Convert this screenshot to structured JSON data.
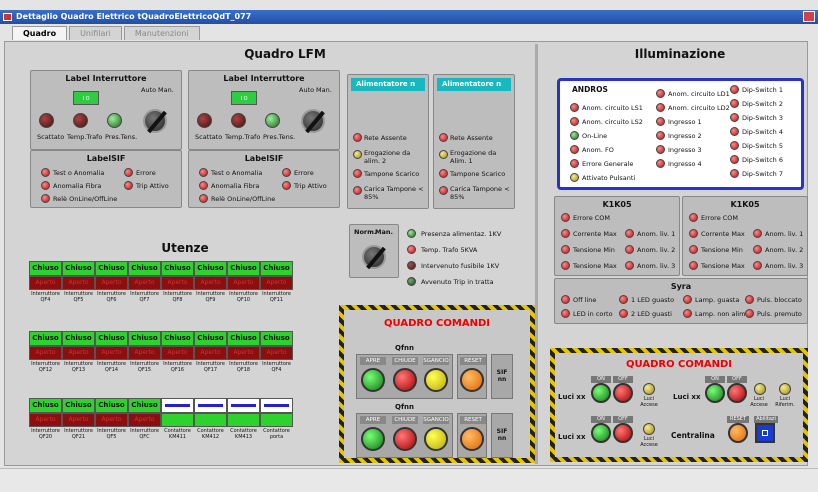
{
  "window": {
    "title": "Dettaglio Quadro Elettrico tQuadroElettricoQdT_077"
  },
  "tabs": [
    {
      "label": "Quadro"
    },
    {
      "label": "Unifilari"
    },
    {
      "label": "Manutenzioni"
    }
  ],
  "lfm": {
    "title": "Quadro LFM",
    "int1": {
      "title": "Label Interruttore",
      "leds": [
        "Scattato",
        "Temp.Trafo",
        "Pres.Tens."
      ],
      "auto": "Auto",
      "man": "Man."
    },
    "int2": {
      "title": "Label Interruttore",
      "leds": [
        "Scattato",
        "Temp.Trafo",
        "Pres.Tens."
      ],
      "auto": "Auto",
      "man": "Man."
    },
    "sif1": {
      "title": "LabelSIF",
      "items": [
        "Test o Anomalia",
        "Anomalia Fibra",
        "Relè OnLine/OffLine",
        "Errore",
        "Trip Attivo"
      ]
    },
    "sif2": {
      "title": "LabelSIF",
      "items": [
        "Test o Anomalia",
        "Anomalia Fibra",
        "Relè OnLine/OffLine",
        "Errore",
        "Trip Attivo"
      ]
    },
    "alim1": {
      "title": "Alimentatore n",
      "items": [
        "Rete Assente",
        "Erogazione da alim. 2",
        "Tampone Scarico",
        "Carica Tampone < 85%"
      ]
    },
    "alim2": {
      "title": "Alimentatore n",
      "items": [
        "Rete Assente",
        "Erogazione da Alim. 1",
        "Tampone Scarico",
        "Carica Tampone < 85%"
      ]
    },
    "sel": {
      "norm": "Norm.",
      "man": "Man.",
      "items": [
        "Presenza alimentaz. 1KV",
        "Temp. Trafo 5KVA",
        "Intervenuto fusibile 1KV",
        "Avvenuto Trip in tratta"
      ]
    }
  },
  "utenze": {
    "title": "Utenze",
    "on": "Chiuso",
    "off": "Aperto",
    "row1": [
      "Interruttore QF4",
      "Interruttore QF5",
      "Interruttore QF6",
      "Interruttore QF7",
      "Interruttore QF8",
      "Interruttore QF9",
      "Interruttore QF10",
      "Interruttore QF11"
    ],
    "row2": [
      "Interruttore QF12",
      "Interruttore QF13",
      "Interruttore QF14",
      "Interruttore QF15",
      "Interruttore QF16",
      "Interruttore QF17",
      "Interruttore QF18",
      "Interruttore QF4"
    ],
    "row3": [
      "Interruttore QF20",
      "Interruttore QF21",
      "Interruttore QF5",
      "Interruttore QFC"
    ],
    "contattori": [
      "Contattore KM411",
      "Contattore KM412",
      "Contattore KM413",
      "Contattore porta"
    ]
  },
  "qc1": {
    "title": "QUADRO COMANDI",
    "group": "Qfnn",
    "apre": "APRE",
    "chiude": "CHIUDE",
    "sgancio": "SGANCIO",
    "reset": "RESET",
    "sif": "SIF nn"
  },
  "illum": {
    "title": "Illuminazione",
    "andros": {
      "title": "ANDROS",
      "col1": [
        "Anom. circuito LS1",
        "Anom. circuito LS2",
        "On-Line",
        "Anom. FO",
        "Errore Generale",
        "Attivato Pulsanti"
      ],
      "col2": [
        "Anom. circuito LD1",
        "Anom. circuito LD2",
        "Ingresso 1",
        "Ingresso 2",
        "Ingresso 3",
        "Ingresso 4"
      ],
      "col3": [
        "Dip-Switch 1",
        "Dip-Switch 2",
        "Dip-Switch 3",
        "Dip-Switch 4",
        "Dip-Switch 5",
        "Dip-Switch 6",
        "Dip-Switch 7"
      ]
    },
    "k1": {
      "title": "K1K05",
      "err": "Errore COM",
      "a": [
        "Corrente Max",
        "Tensione Min",
        "Tensione Max"
      ],
      "b": [
        "Anom. liv. 1",
        "Anom. liv. 2",
        "Anom. liv. 3"
      ]
    },
    "k2": {
      "title": "K1K05",
      "err": "Errore COM",
      "a": [
        "Corrente Max",
        "Tensione Min",
        "Tensione Max"
      ],
      "b": [
        "Anom. liv. 1",
        "Anom. liv. 2",
        "Anom. liv. 3"
      ]
    },
    "syra": {
      "title": "Syra",
      "items": [
        "Off line",
        "1 LED guasto",
        "Lamp. guasta",
        "Puls. bloccato",
        "LED in corto",
        "2 LED guasti",
        "Lamp. non alim.",
        "Puls. premuto"
      ]
    }
  },
  "qc2": {
    "title": "QUADRO COMANDI",
    "luci": "Luci xx",
    "on": "ON",
    "off": "OFF",
    "accese": "Luci Accese",
    "riferim": "Luci Riferim.",
    "centralina": "Centralina",
    "reset": "RESET",
    "abilit": "Abilitazi"
  }
}
